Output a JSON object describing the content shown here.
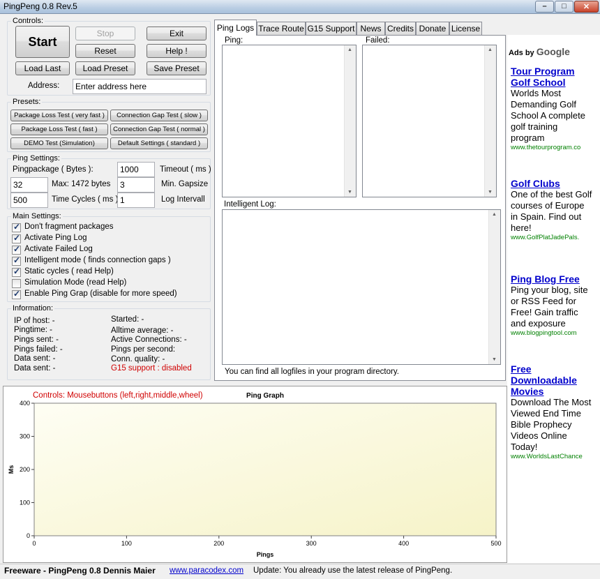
{
  "window": {
    "title": "PingPeng 0.8 Rev.5"
  },
  "controls": {
    "label": "Controls:",
    "start": "Start",
    "stop": "Stop",
    "exit": "Exit",
    "reset": "Reset",
    "help": "Help !",
    "load_last": "Load Last",
    "load_preset": "Load Preset",
    "save_preset": "Save Preset",
    "address_label": "Address:",
    "address_value": "Enter address here"
  },
  "presets": {
    "label": "Presets:",
    "b1": "Package Loss Test ( very fast )",
    "b2": "Connection Gap Test ( slow )",
    "b3": "Package Loss Test ( fast )",
    "b4": "Connection Gap Test ( normal )",
    "b5": "DEMO Test (Simulation)",
    "b6": "Default Settings ( standard )"
  },
  "ping_settings": {
    "label": "Ping Settings:",
    "pingpackage_label": "Pingpackage ( Bytes ):",
    "pingpackage_value": "1000",
    "timeout_label": "Timeout ( ms )",
    "size_value": "32",
    "max_label": "Max: 1472 bytes",
    "gapsize_value": "3",
    "gapsize_label": "Min. Gapsize",
    "cycles_value": "500",
    "cycles_label": "Time Cycles ( ms )",
    "interval_value": "1",
    "interval_label": "Log Intervall"
  },
  "main_settings": {
    "label": "Main Settings:",
    "items": [
      {
        "label": "Don't fragment packages",
        "checked": true
      },
      {
        "label": "Activate Ping Log",
        "checked": true
      },
      {
        "label": "Activate Failed Log",
        "checked": true
      },
      {
        "label": "Intelligent mode ( finds connection gaps )",
        "checked": true
      },
      {
        "label": "Static cycles ( read Help)",
        "checked": true
      },
      {
        "label": "Simulation Mode (read Help)",
        "checked": false
      },
      {
        "label": "Enable Ping Grap (disable for more speed)",
        "checked": true
      }
    ]
  },
  "information": {
    "label": "Information:",
    "ip": "IP of host: -",
    "pingtime": "Pingtime: -",
    "pings_sent": "Pings sent: -",
    "pings_failed": "Pings failed: -",
    "data_sent1": "Data sent: -",
    "data_sent2": "Data sent: -",
    "started": "Started: -",
    "alltime": "Alltime average: -",
    "active": "Active Connections: -",
    "pps": "Pings per second:",
    "quality": "Conn. quality: -",
    "g15": "G15 support : disabled"
  },
  "tabs": [
    "Ping Logs",
    "Trace Route",
    "G15 Support",
    "News",
    "Credits",
    "Donate",
    "License"
  ],
  "logs": {
    "ping_label": "Ping:",
    "failed_label": "Failed:",
    "intelligent_label": "Intelligent Log:",
    "footer": "You can find all logfiles in your program directory."
  },
  "graph": {
    "controls_hint": "Controls: Mousebuttons (left,right,middle,wheel)"
  },
  "chart_data": {
    "type": "line",
    "title": "Ping Graph",
    "xlabel": "Pings",
    "ylabel": "Ms",
    "xlim": [
      0,
      500
    ],
    "ylim": [
      0,
      400
    ],
    "xticks": [
      0,
      100,
      200,
      300,
      400,
      500
    ],
    "yticks": [
      0,
      100,
      200,
      300,
      400
    ],
    "series": []
  },
  "ads": {
    "header_prefix": "Ads by",
    "header_brand": "Google",
    "items": [
      {
        "title": "Tour Program Golf School",
        "body": "Worlds Most Demanding Golf School A complete golf training program",
        "url": "www.thetourprogram.co"
      },
      {
        "title": "Golf Clubs",
        "body": "One of the best Golf courses of Europe in Spain. Find out here!",
        "url": "www.GolfPlatJadePals."
      },
      {
        "title": "Ping Blog Free",
        "body": "Ping your blog, site or RSS Feed for Free! Gain traffic and exposure",
        "url": "www.blogpingtool.com"
      },
      {
        "title": "Free Downloadable Movies",
        "body": "Download The Most Viewed End Time Bible Prophecy Videos Online Today!",
        "url": "www.WorldsLastChance"
      }
    ]
  },
  "status": {
    "freeware": "Freeware - PingPeng 0.8 Dennis Maier",
    "link": "www.paracodex.com",
    "update": "Update: You already use the latest release of PingPeng."
  },
  "colors": {
    "graph_bg": "#fbf9dc",
    "accent_red": "#d00000",
    "link_blue": "#0000cc",
    "url_green": "#008000"
  }
}
